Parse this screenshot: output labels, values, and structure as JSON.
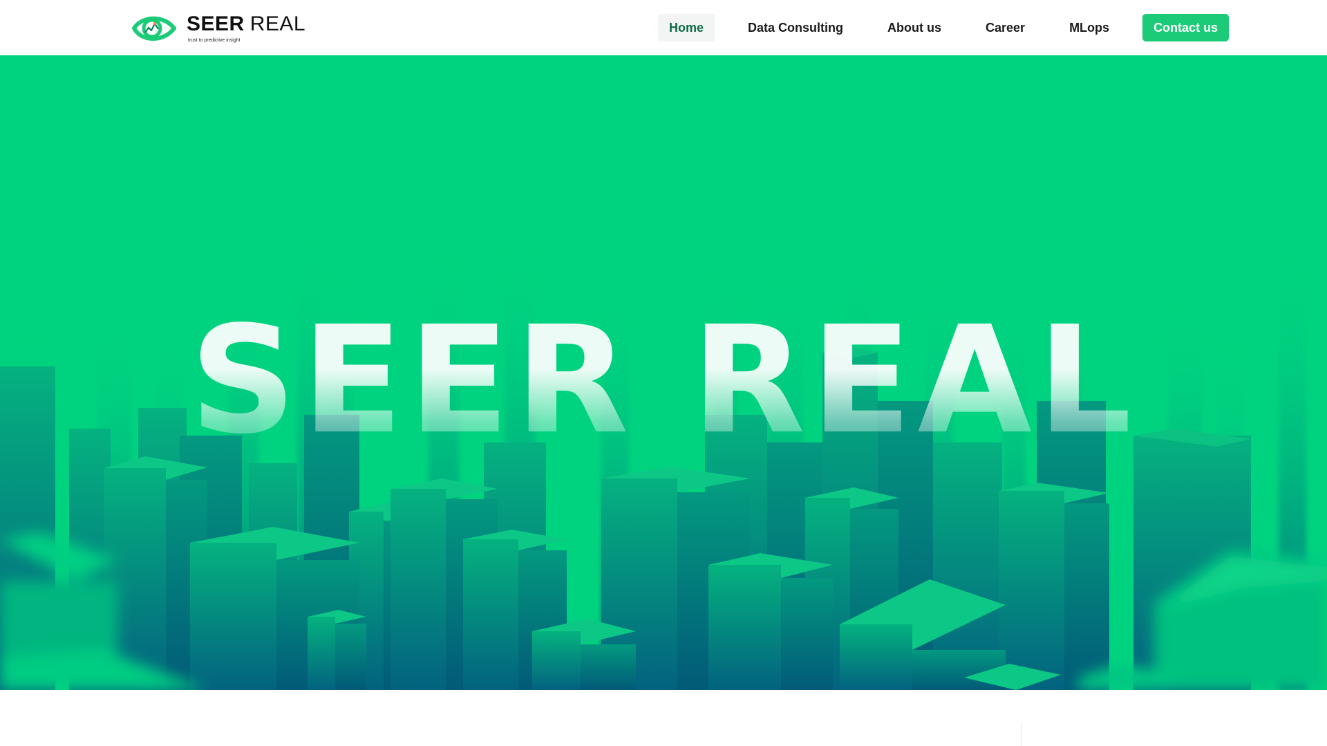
{
  "brand": {
    "name_bold": "SEER",
    "name_light": "REAL",
    "tagline": "trust to predictive insight",
    "accent_color": "#1ccb78",
    "logo_icon": "eye-chart-icon"
  },
  "nav": {
    "items": [
      {
        "label": "Home",
        "active": true
      },
      {
        "label": "Data Consulting",
        "active": false
      },
      {
        "label": "About us",
        "active": false
      },
      {
        "label": "Career",
        "active": false
      },
      {
        "label": "MLops",
        "active": false
      }
    ],
    "cta_label": "Contact us"
  },
  "hero": {
    "title": "SEER REAL",
    "background_color": "#00d37f",
    "building_color_dark": "#03627f"
  }
}
